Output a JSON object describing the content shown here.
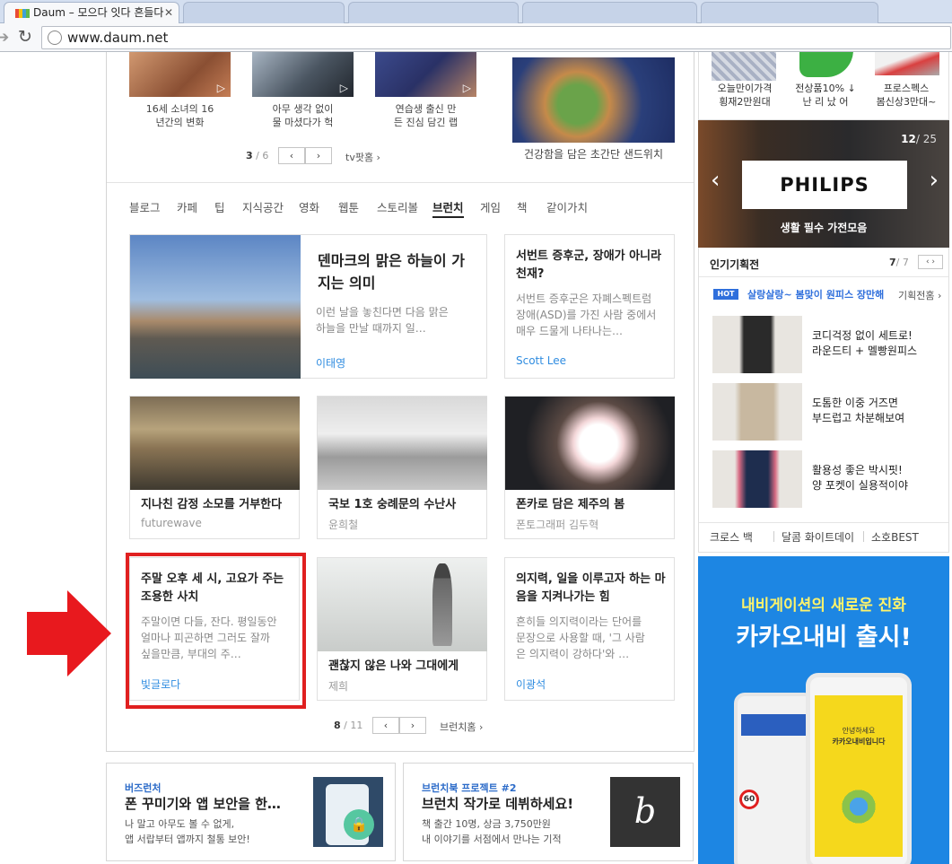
{
  "browser": {
    "tab_title": "Daum – 모으다 잇다 흔들다",
    "url": "www.daum.net"
  },
  "videos": [
    {
      "caption_l1": "16세 소녀의 16",
      "caption_l2": "년간의 변화"
    },
    {
      "caption_l1": "아무 생각 없이",
      "caption_l2": "물 마셨다가 헉"
    },
    {
      "caption_l1": "연습생 출신 만",
      "caption_l2": "든 진심 담긴 랩"
    }
  ],
  "food": {
    "caption": "건강함을 담은 초간단 샌드위치"
  },
  "tv_pager": {
    "current": "3",
    "total": "/ 6",
    "link": "tv팟홈 ›"
  },
  "categories": [
    "블로그",
    "카페",
    "팁",
    "지식공간",
    "영화",
    "웹툰",
    "스토리볼",
    "브런치",
    "게임",
    "책",
    "같이가치"
  ],
  "cards": {
    "c1": {
      "title_l1": "덴마크의 맑은 하늘이 가",
      "title_l2": "지는 의미",
      "sum_l1": "이런 날을 놓친다면 다음 맑은",
      "sum_l2": "하늘을 만날 때까지 일…",
      "author": "이태영"
    },
    "c2": {
      "title_l1": "서번트 증후군, 장애가 아니라",
      "title_l2": "천재?",
      "sum_l1": "서번트 증후군은 자폐스펙트럼",
      "sum_l2": "장애(ASD)를 가진 사람 중에서",
      "sum_l3": "매우 드물게 나타나는…",
      "author": "Scott Lee"
    },
    "c3": {
      "title": "지나친 감정 소모를 거부한다",
      "author": "futurewave"
    },
    "c4": {
      "title": "국보 1호 숭례문의 수난사",
      "author": "윤희철"
    },
    "c5": {
      "title": "폰카로 담은 제주의 봄",
      "author": "폰토그래퍼 김두혁"
    },
    "c6": {
      "title_l1": "주말 오후 세 시, 고요가 주는",
      "title_l2": "조용한 사치",
      "sum_l1": "주말이면 다들, 잔다. 평일동안",
      "sum_l2": "얼마나 피곤하면 그러도 잘까",
      "sum_l3": "싶을만큼, 부대의 주…",
      "author": "빛글로다"
    },
    "c7": {
      "title": "괜찮지 않은 나와 그대에게",
      "author": "제희"
    },
    "c8": {
      "title_l1": "의지력, 일을 이루고자 하는 마",
      "title_l2": "음을 지켜나가는 힘",
      "sum_l1": "흔히들 의지력이라는 단어를",
      "sum_l2": "문장으로 사용할 때, '그 사람",
      "sum_l3": "은 의지력이 강하다'와 …",
      "author": "이광석"
    }
  },
  "brunch_pager": {
    "current": "8",
    "total": "/ 11",
    "link": "브런치홈 ›"
  },
  "bottom": {
    "b1": {
      "tag": "버즈런처",
      "title": "폰 꾸미기와 앱 보안을 한…",
      "l1": "나 말고 아무도 볼 수 없게,",
      "l2": "앱 서랍부터 앱까지 철통 보안!"
    },
    "b2": {
      "tag": "브런치북 프로젝트 #2",
      "title": "브런치 작가로 데뷔하세요!",
      "l1": "책 출간 10명, 상금 3,750만원",
      "l2": "내 이야기를 서점에서 만나는 기적"
    }
  },
  "shopping": {
    "items": [
      {
        "l1": "오늘만이가격",
        "l2": "횡재2만원대"
      },
      {
        "l1": "전상품10% ↓",
        "l2": "난 리 났 어"
      },
      {
        "l1": "프로스펙스",
        "l2": "봄신상3만대~"
      }
    ]
  },
  "banner": {
    "page": "12",
    "total": "/ 25",
    "brand": "PHILIPS",
    "caption": "생활 필수 가전모음"
  },
  "planned": {
    "title": "인기기획전",
    "page": "7",
    "total": "/ 7",
    "hot": "HOT",
    "hot_text": "살랑살랑~ 봄맞이 원피스 장만해",
    "hot_link": "기획전홈 ›",
    "items": [
      {
        "l1": "코디걱정 없이 세트로!",
        "l2": "라운드티 + 멜빵원피스"
      },
      {
        "l1": "도톰한 이중 거즈면",
        "l2": "부드럽고 차분해보여"
      },
      {
        "l1": "활용성 좋은 박시핏!",
        "l2": "양 포켓이 실용적이야"
      }
    ],
    "links": [
      "크로스 백",
      "달콤 화이트데이",
      "소호BEST"
    ]
  },
  "ad": {
    "headline": "내비게이션의 새로운 진화",
    "title": "카카오내비 출시!",
    "phone_l1": "안녕하세요",
    "phone_l2": "카카오내비입니다"
  }
}
